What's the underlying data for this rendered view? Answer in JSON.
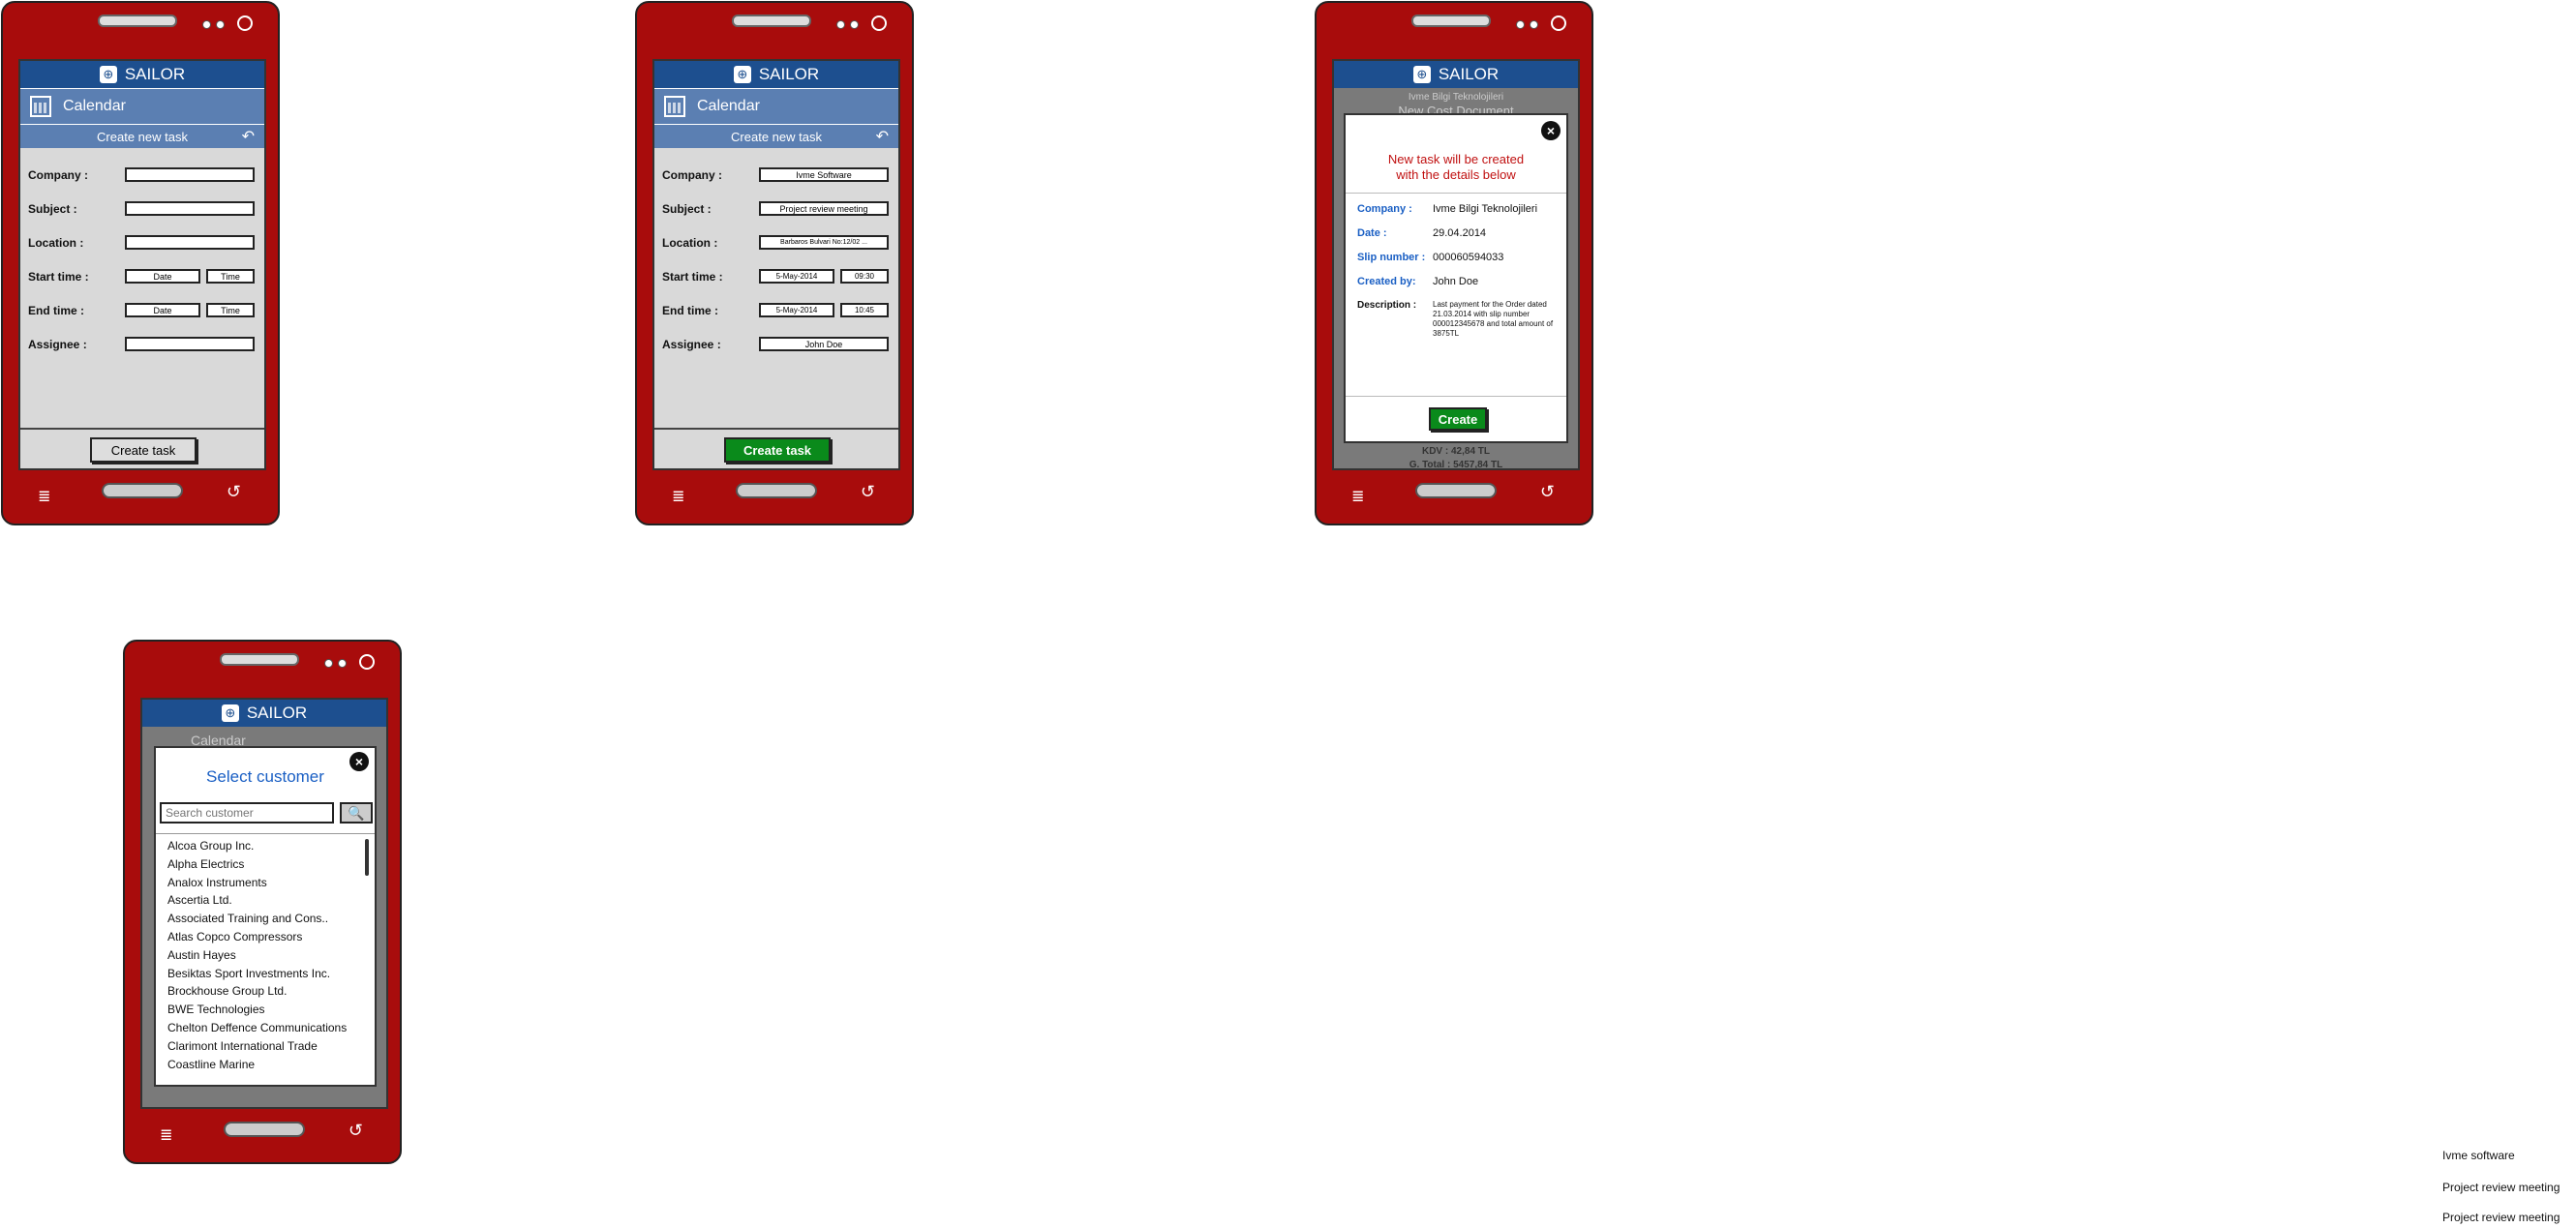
{
  "app": {
    "title": "SAILOR",
    "section": "Calendar",
    "subtitle": "Create new task"
  },
  "form_empty": {
    "labels": [
      "Company :",
      "Subject :",
      "Location :",
      "Start time :",
      "End time :",
      "Assignee :"
    ],
    "date_placeholder": "Date",
    "time_placeholder": "Time",
    "button": "Create task"
  },
  "form_filled": {
    "labels": [
      "Company :",
      "Subject :",
      "Location :",
      "Start time :",
      "End time :",
      "Assignee :"
    ],
    "company": "Ivme Software",
    "subject": "Project review meeting",
    "location": "Barbaros Bulvari No:12/02 ...",
    "start_date": "5-May-2014",
    "start_time": "09:30",
    "end_date": "5-May-2014",
    "end_time": "10:45",
    "assignee": "John Doe",
    "button": "Create task"
  },
  "confirm": {
    "bg_top": "Ivme Bilgi Teknolojileri",
    "bg_heading": "New Cost Document",
    "bg_bottom1": "KDV : 42,84 TL",
    "bg_bottom2": "G. Total : 5457,84 TL",
    "title_line1": "New task will be created",
    "title_line2": "with the details below",
    "company_label": "Company :",
    "company_value": "Ivme Bilgi Teknolojileri",
    "date_label": "Date :",
    "date_value": "29.04.2014",
    "slip_label": "Slip number :",
    "slip_value": "000060594033",
    "created_label": "Created by:",
    "created_value": "John Doe",
    "desc_label": "Description :",
    "desc_value": "Last payment for the Order dated 21.03.2014 with slip number 000012345678 and total amount of 3875TL",
    "button": "Create"
  },
  "customer": {
    "title": "Select customer",
    "search_placeholder": "Search customer",
    "bg_calendar": "Calendar",
    "items": [
      "Alcoa Group Inc.",
      "Alpha Electrics",
      "Analox Instruments",
      "Ascertia Ltd.",
      "Associated Training and Cons..",
      "Atlas Copco Compressors",
      "Austin Hayes",
      "Besiktas Sport Investments Inc.",
      "Brockhouse Group Ltd.",
      "BWE Technologies",
      "Chelton Deffence Communications",
      "Clarimont International Trade",
      "Coastline Marine"
    ]
  },
  "side_notes": [
    "Ivme software",
    "Project review meeting",
    "Project review meeting"
  ],
  "colors": {
    "phone": "#a80c0c",
    "appbar": "#1d4f8f",
    "subbar": "#5b7fb2",
    "accent_green": "#0a8a1b",
    "modal_title": "#c01010",
    "detail_key": "#1a5fc4"
  }
}
